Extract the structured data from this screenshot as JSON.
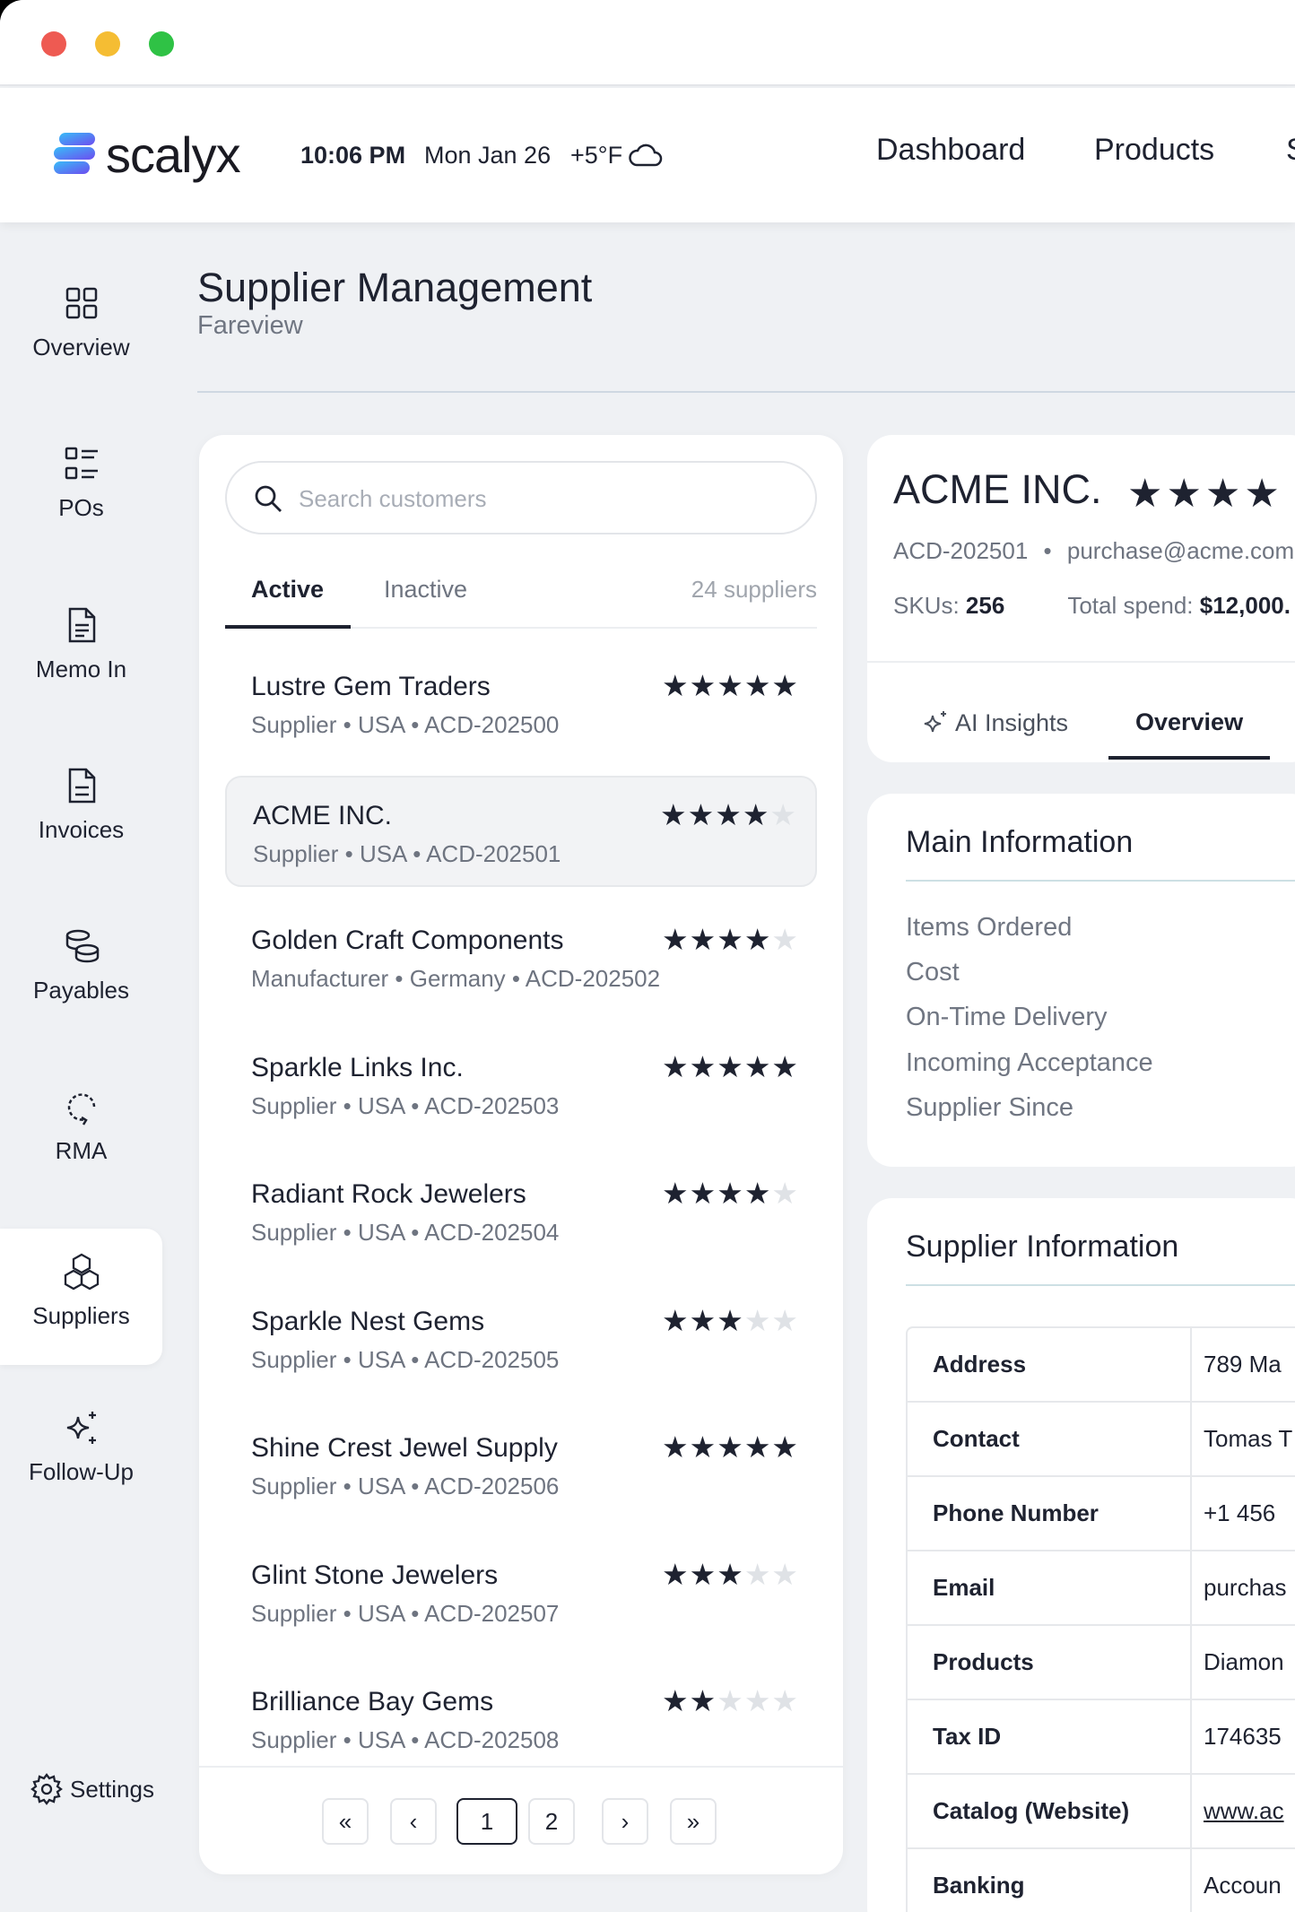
{
  "app": {
    "logo_text": "scalyx"
  },
  "header": {
    "time": "10:06 PM",
    "date": "Mon Jan 26",
    "temp": "+5°F",
    "nav": [
      "Dashboard",
      "Products",
      "S"
    ]
  },
  "sidebar": {
    "items": [
      {
        "label": "Overview",
        "icon": "grid-icon"
      },
      {
        "label": "POs",
        "icon": "list-icon"
      },
      {
        "label": "Memo In",
        "icon": "document-icon"
      },
      {
        "label": "Invoices",
        "icon": "invoice-icon"
      },
      {
        "label": "Payables",
        "icon": "coins-icon"
      },
      {
        "label": "RMA",
        "icon": "return-icon"
      },
      {
        "label": "Suppliers",
        "icon": "boxes-icon"
      },
      {
        "label": "Follow-Up",
        "icon": "sparkle-icon"
      }
    ],
    "settings": "Settings"
  },
  "page": {
    "title": "Supplier Management",
    "subtitle": "Fareview"
  },
  "list": {
    "search_placeholder": "Search customers",
    "tab_active": "Active",
    "tab_inactive": "Inactive",
    "count": "24 suppliers",
    "suppliers": [
      {
        "name": "Lustre Gem Traders",
        "meta": "Supplier • USA • ACD-202500",
        "rating": 5
      },
      {
        "name": "ACME INC.",
        "meta": "Supplier • USA • ACD-202501",
        "rating": 4
      },
      {
        "name": "Golden Craft Components",
        "meta": "Manufacturer • Germany • ACD-202502",
        "rating": 4
      },
      {
        "name": "Sparkle Links Inc.",
        "meta": "Supplier • USA • ACD-202503",
        "rating": 5
      },
      {
        "name": "Radiant Rock Jewelers",
        "meta": "Supplier • USA • ACD-202504",
        "rating": 4
      },
      {
        "name": "Sparkle Nest Gems",
        "meta": "Supplier • USA • ACD-202505",
        "rating": 3
      },
      {
        "name": "Shine Crest Jewel Supply",
        "meta": "Supplier • USA • ACD-202506",
        "rating": 5
      },
      {
        "name": "Glint Stone Jewelers",
        "meta": "Supplier • USA • ACD-202507",
        "rating": 3
      },
      {
        "name": "Brilliance Bay Gems",
        "meta": "Supplier • USA • ACD-202508",
        "rating": 2
      }
    ],
    "pager": {
      "first": "«",
      "prev": "‹",
      "page1": "1",
      "page2": "2",
      "next": "›",
      "last": "»"
    }
  },
  "detail": {
    "name": "ACME INC.",
    "rating": 4,
    "code": "ACD-202501",
    "email": "purchase@acme.com",
    "skus_label": "SKUs:",
    "skus_value": "256",
    "spend_label": "Total spend:",
    "spend_value": "$12,000.",
    "tab_ai": "AI Insights",
    "tab_overview": "Overview"
  },
  "main_info": {
    "title": "Main Information",
    "fields": [
      "Items Ordered",
      "Cost",
      "On-Time Delivery",
      "Incoming Acceptance",
      "Supplier Since"
    ]
  },
  "supplier_info": {
    "title": "Supplier Information",
    "rows": [
      {
        "key": "Address",
        "value": "789 Ma"
      },
      {
        "key": "Contact",
        "value": "Tomas T"
      },
      {
        "key": "Phone Number",
        "value": "+1 456"
      },
      {
        "key": "Email",
        "value": "purchas"
      },
      {
        "key": "Products",
        "value": "Diamon"
      },
      {
        "key": "Tax ID",
        "value": "174635"
      },
      {
        "key": "Catalog (Website)",
        "value": "www.ac"
      },
      {
        "key": "Banking",
        "value": "Accoun"
      }
    ]
  },
  "colors": {
    "accent": "#1e2230",
    "logo_blue": "#3b82f6",
    "logo_purple": "#6d4cf0",
    "background": "#eff1f4"
  }
}
